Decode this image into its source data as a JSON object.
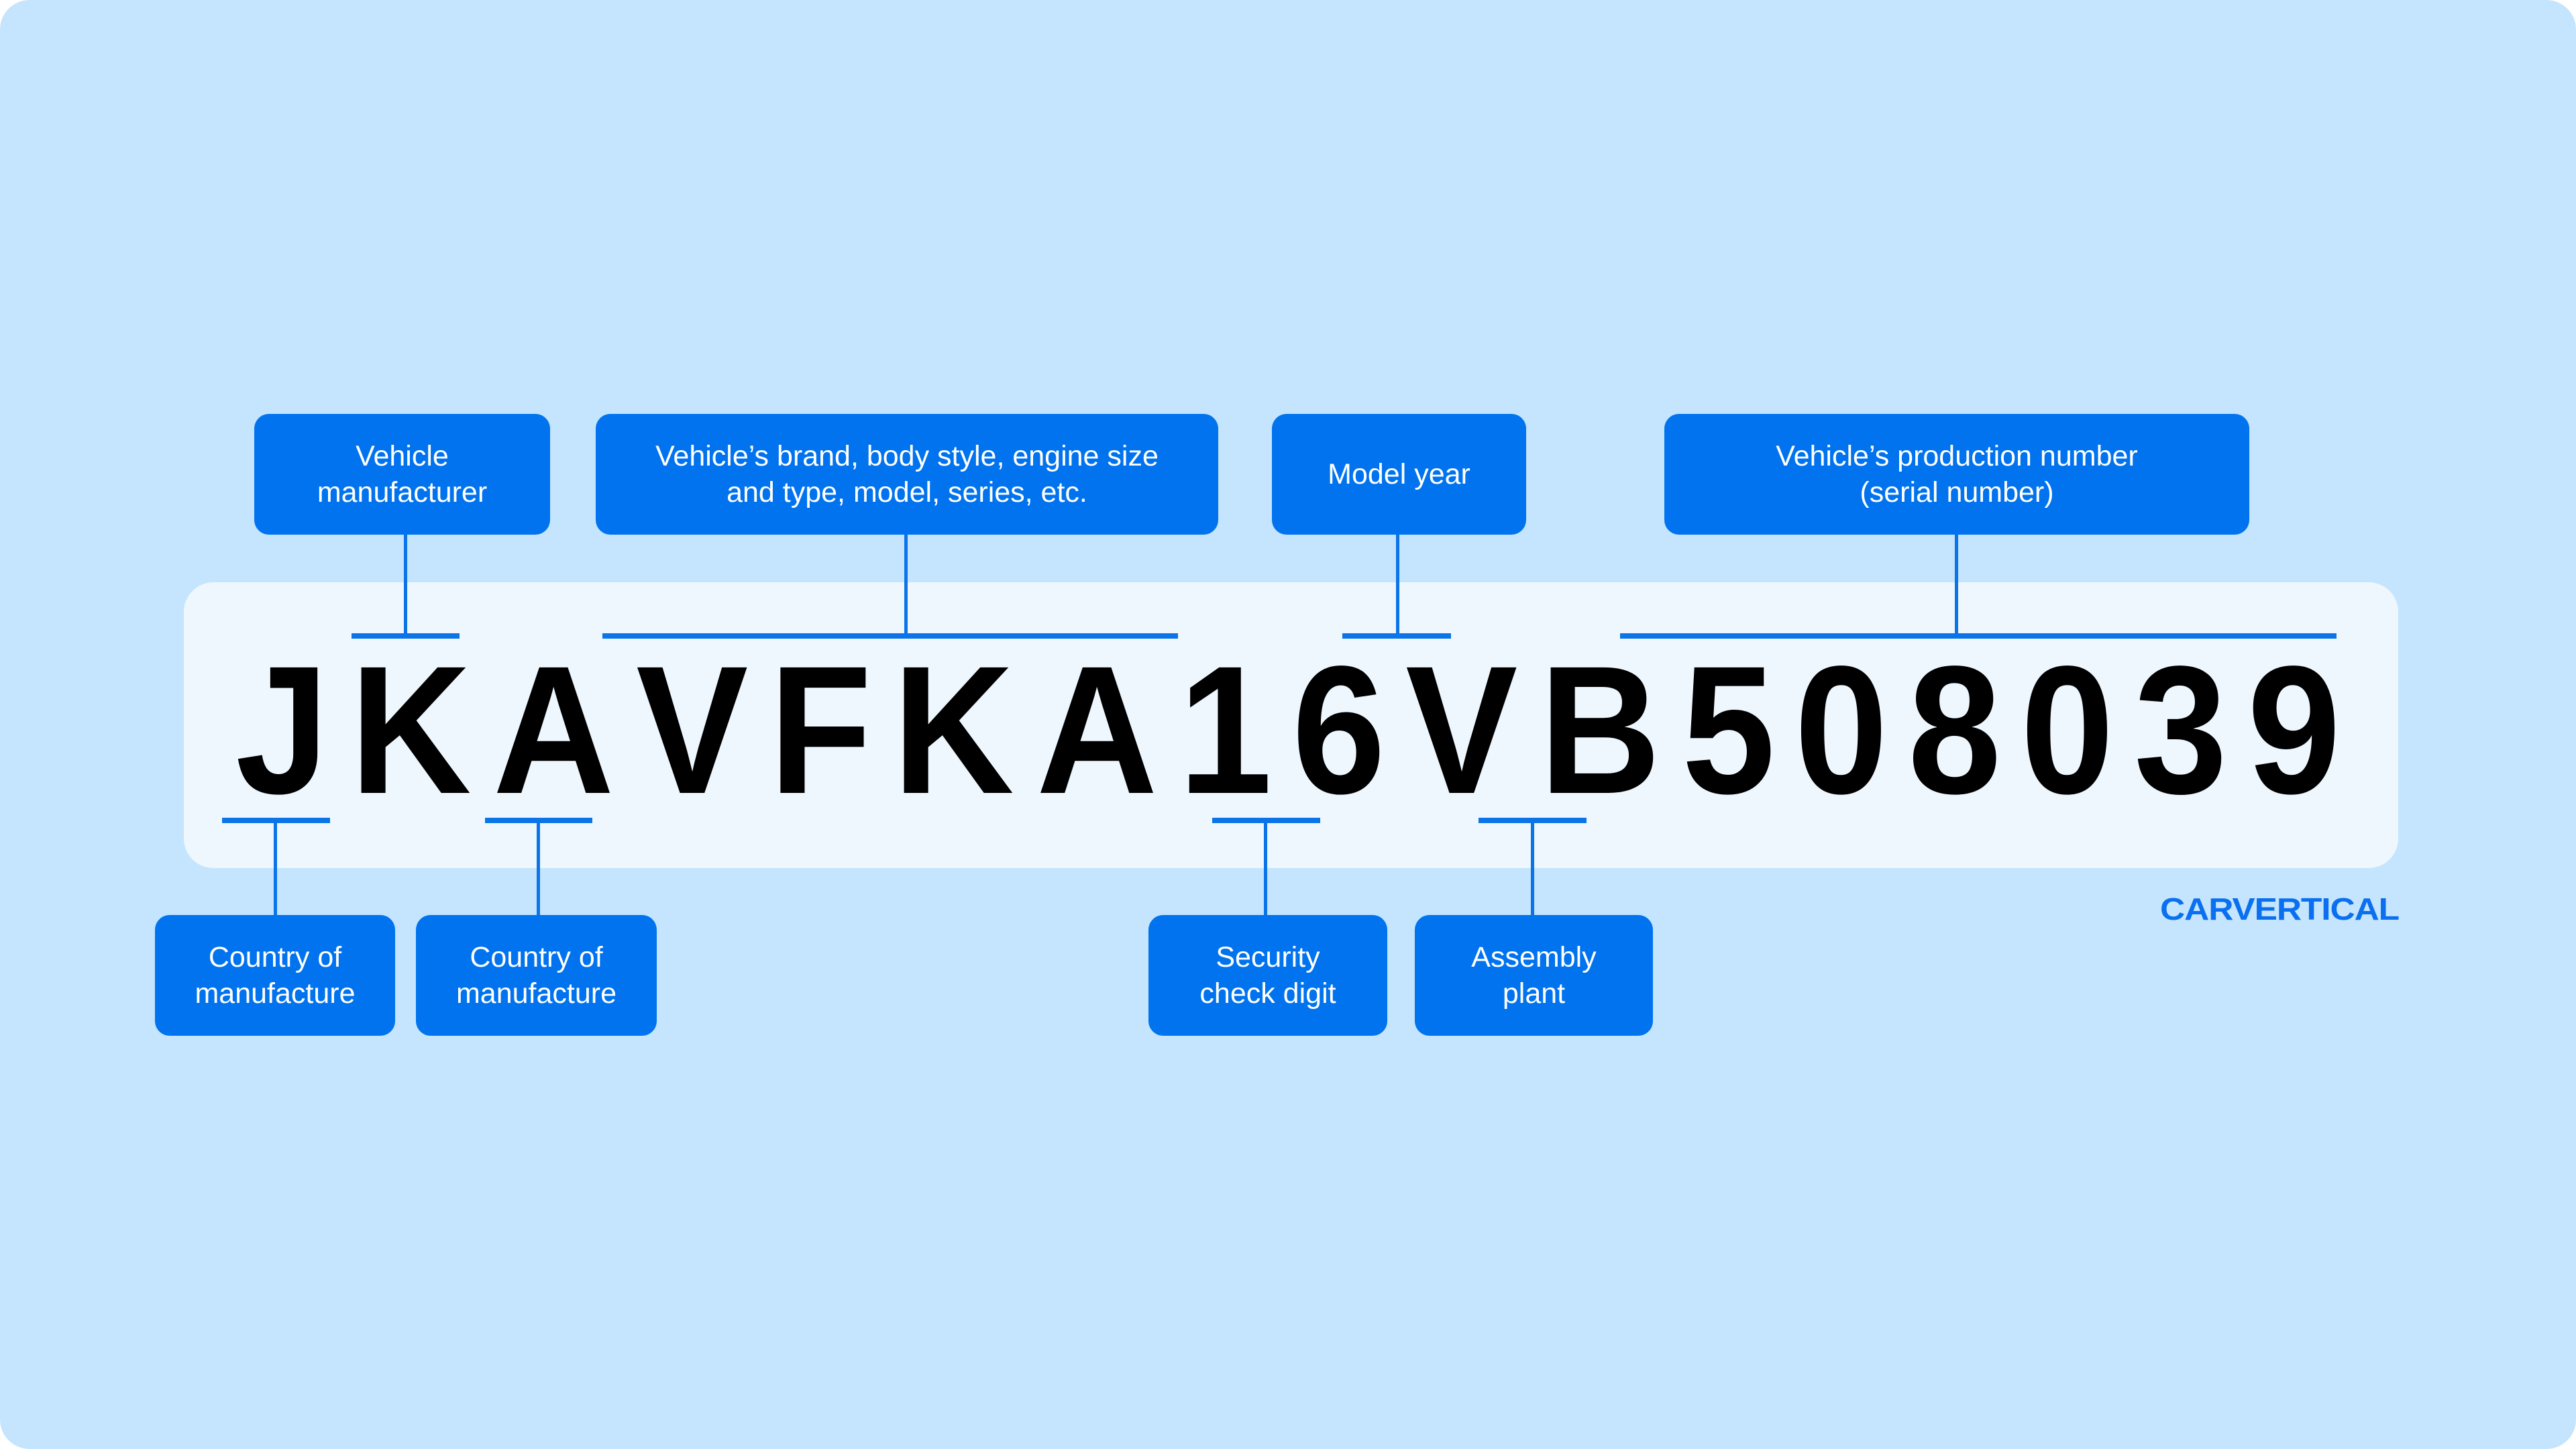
{
  "vin": {
    "code": "JKAVFKA16VB508039",
    "characters": [
      "J",
      "K",
      "A",
      "V",
      "F",
      "K",
      "A",
      "1",
      "6",
      "V",
      "B",
      "5",
      "0",
      "8",
      "0",
      "3",
      "9"
    ]
  },
  "top_labels": [
    {
      "id": "vehicle-manufacturer",
      "text": "Vehicle\nmanufacturer",
      "positions": [
        3
      ]
    },
    {
      "id": "vehicle-descriptor",
      "text": "Vehicle’s brand, body style, engine size\nand type, model, series, etc.",
      "positions": [
        4,
        5,
        6,
        7,
        8
      ]
    },
    {
      "id": "model-year",
      "text": "Model year",
      "positions": [
        10
      ]
    },
    {
      "id": "serial-number",
      "text": "Vehicle’s production number\n(serial number)",
      "positions": [
        12,
        13,
        14,
        15,
        16,
        17
      ]
    }
  ],
  "bottom_labels": [
    {
      "id": "country-of-manufacture-1",
      "text": "Country of\nmanufacture",
      "positions": [
        1
      ]
    },
    {
      "id": "country-of-manufacture-2",
      "text": "Country of\nmanufacture",
      "positions": [
        3
      ]
    },
    {
      "id": "security-check-digit",
      "text": "Security\ncheck digit",
      "positions": [
        9
      ]
    },
    {
      "id": "assembly-plant",
      "text": "Assembly\nplant",
      "positions": [
        11
      ]
    }
  ],
  "brand": {
    "logo_text": "CARVERTICAL"
  },
  "colors": {
    "background": "#c4e5fd",
    "panel": "#eef7fe",
    "accent": "#0173ee",
    "vin_text": "#000000",
    "label_text": "#ffffff"
  }
}
